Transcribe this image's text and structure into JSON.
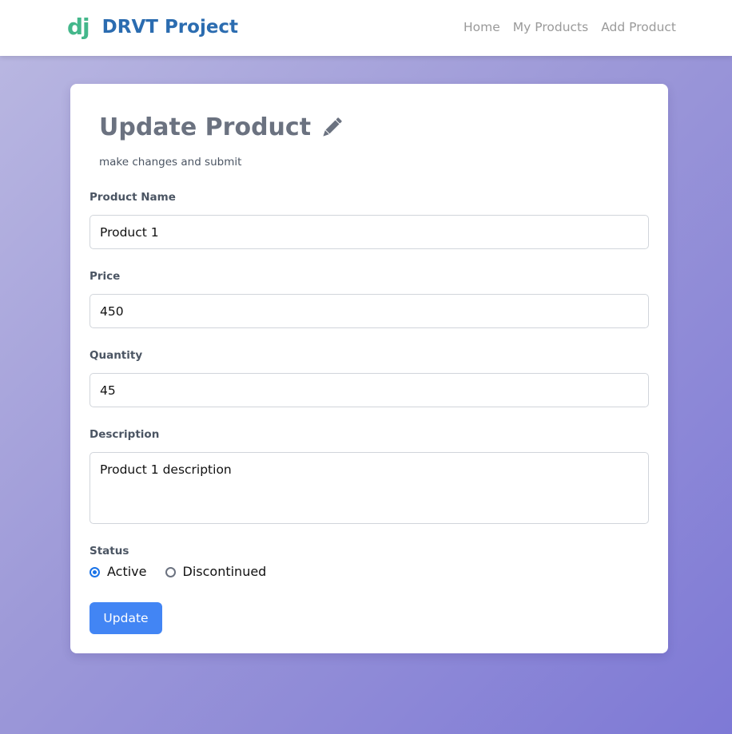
{
  "navbar": {
    "logo": "dj",
    "brand": "DRVT Project",
    "links": [
      "Home",
      "My Products",
      "Add Product"
    ]
  },
  "form": {
    "title": "Update Product",
    "subtitle": "make changes and submit",
    "fields": {
      "name": {
        "label": "Product Name",
        "value": "Product 1"
      },
      "price": {
        "label": "Price",
        "value": "450"
      },
      "quantity": {
        "label": "Quantity",
        "value": "45"
      },
      "description": {
        "label": "Description",
        "value": "Product 1 description"
      }
    },
    "status": {
      "label": "Status",
      "options": [
        "Active",
        "Discontinued"
      ],
      "selected": "Active"
    },
    "submit_label": "Update"
  },
  "colors": {
    "logo": "#44b78b",
    "brand": "#2b6cb0",
    "button": "#4285f4",
    "radio_checked": "#1a73e8"
  }
}
